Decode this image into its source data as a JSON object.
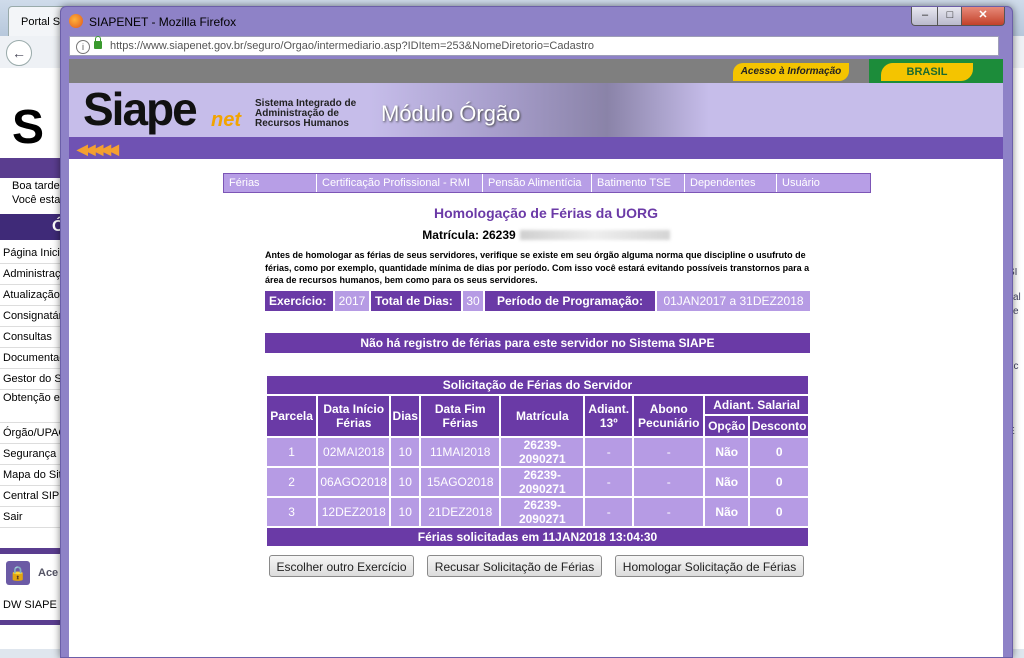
{
  "background_window": {
    "tab_title": "Portal SIAPE",
    "logo": "S",
    "greeting": [
      "Boa tarde",
      "Você esta"
    ],
    "section": "Ó",
    "menu": [
      "Página Inicial",
      "Administração",
      "Atualização",
      "Consignatárias",
      "Consultas",
      "Documentação",
      "Gestor do SIAPE",
      "Obtenção e Arquivos",
      "Órgão/UPAG",
      "Segurança",
      "Mapa do Site",
      "Central SIPEC",
      "Sair"
    ],
    "acesso": "Ace",
    "dw": "DW SIAPE",
    "right_text": [
      "SI",
      "sal",
      "se",
      "nc",
      "E"
    ]
  },
  "window": {
    "title": "SIAPENET - Mozilla Firefox",
    "url": "https://www.siapenet.gov.br/seguro/Orgao/intermediario.asp?IDItem=253&NomeDiretorio=Cadastro",
    "minimize": "–",
    "maximize": "□",
    "close": "✕"
  },
  "gov_bar": {
    "acesso": "Acesso à Informação",
    "brasil": "BRASIL"
  },
  "header": {
    "logo": "Siape",
    "logo_net": "net",
    "system_name": [
      "Sistema Integrado de",
      "Administração de",
      "Recursos Humanos"
    ],
    "module": "Módulo Órgão",
    "arrows": "◀◀◀◀◀"
  },
  "tabs": [
    "Férias",
    "Certificação Profissional - RMI",
    "Pensão Alimentícia",
    "Batimento TSE",
    "Dependentes",
    "Usuário"
  ],
  "page": {
    "title": "Homologação de Férias da UORG",
    "matricula_label": "Matrícula:",
    "matricula_value": "26239",
    "note": "Antes de homologar as férias de seus servidores, verifique se existe em seu órgão alguma norma que discipline o usufruto de férias, como por exemplo, quantidade mínima de dias por período. Com isso você estará evitando possíveis transtornos para a área de recursos humanos, bem como para os seus servidores."
  },
  "info": {
    "exercicio_label": "Exercício:",
    "exercicio_value": "2017",
    "total_label": "Total de Dias:",
    "total_value": "30",
    "periodo_label": "Período de Programação:",
    "periodo_value": "01JAN2017 a 31DEZ2018"
  },
  "no_record": "Não há registro de férias para este servidor no Sistema SIAPE",
  "table": {
    "caption": "Solicitação de Férias do Servidor",
    "headers": [
      "Parcela",
      "Data Início Férias",
      "Dias",
      "Data Fim Férias",
      "Matrícula",
      "Adiant. 13º",
      "Abono Pecuniário",
      "Adiant. Salarial",
      "Opção",
      "Desconto"
    ],
    "rows": [
      [
        "1",
        "02MAI2018",
        "10",
        "11MAI2018",
        "26239-2090271",
        "-",
        "-",
        "Não",
        "0"
      ],
      [
        "2",
        "06AGO2018",
        "10",
        "15AGO2018",
        "26239-2090271",
        "-",
        "-",
        "Não",
        "0"
      ],
      [
        "3",
        "12DEZ2018",
        "10",
        "21DEZ2018",
        "26239-2090271",
        "-",
        "-",
        "Não",
        "0"
      ]
    ],
    "footer": "Férias solicitadas em 11JAN2018 13:04:30"
  },
  "buttons": {
    "choose": "Escolher outro Exercício",
    "refuse": "Recusar Solicitação de Férias",
    "approve": "Homologar Solicitação de Férias"
  },
  "colors": {
    "dark_purple": "#6a3aa6",
    "light_purple": "#b69be4",
    "title_purple": "#6b3aa7",
    "gov_yellow": "#f4c400",
    "gov_green": "#1c8c3a"
  }
}
